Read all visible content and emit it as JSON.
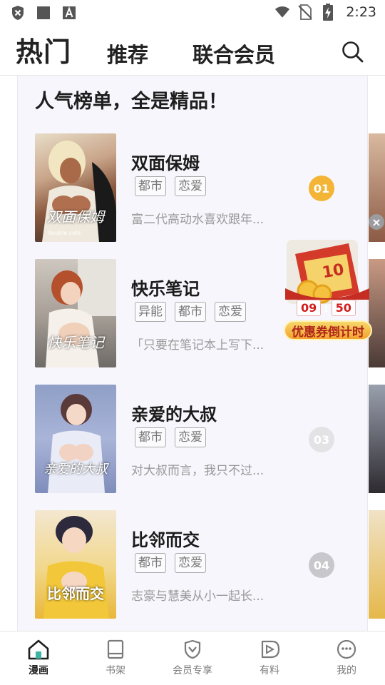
{
  "status_bar": {
    "time": "2:23",
    "icons": [
      "shield-x-icon",
      "square-icon",
      "text-a-icon",
      "wifi-icon",
      "no-sim-icon",
      "battery-charging-icon"
    ]
  },
  "header": {
    "tabs": [
      "热门",
      "推荐",
      "联合会员"
    ],
    "active_tab": "热门",
    "search_icon": "search-icon"
  },
  "ranking": {
    "title": "人气榜单，全是精品！",
    "items": [
      {
        "rank": "01",
        "title": "双面保姆",
        "tags": [
          "都市",
          "恋爱"
        ],
        "desc": "富二代高动水喜欢跟年...",
        "cover_text": "双面保姆",
        "cover_sub": "double side",
        "rank_color": "#f4b536"
      },
      {
        "rank": "02",
        "title": "快乐笔记",
        "tags": [
          "异能",
          "都市",
          "恋爱"
        ],
        "desc": "「只要在笔记本上写下...",
        "cover_text": "快乐笔记",
        "cover_sub": "",
        "rank_color": "#f0a030"
      },
      {
        "rank": "03",
        "title": "亲爱的大叔",
        "tags": [
          "都市",
          "恋爱"
        ],
        "desc": "对大叔而言，我只不过...",
        "cover_text": "亲爱的大叔",
        "cover_sub": "",
        "rank_color": "#e3e3e6"
      },
      {
        "rank": "04",
        "title": "比邻而交",
        "tags": [
          "都市",
          "恋爱"
        ],
        "desc": "志豪与慧美从小一起长...",
        "cover_text": "比邻而交",
        "cover_sub": "",
        "rank_color": "#c8c8cc"
      }
    ]
  },
  "coupon": {
    "amount": "10",
    "timer_min": "09",
    "timer_sec": "50",
    "label": "优惠券倒计时"
  },
  "bottom_nav": {
    "items": [
      {
        "label": "漫画",
        "icon": "home-icon",
        "active": true
      },
      {
        "label": "书架",
        "icon": "book-icon",
        "active": false
      },
      {
        "label": "会员专享",
        "icon": "vip-shield-icon",
        "active": false
      },
      {
        "label": "有料",
        "icon": "play-bubble-icon",
        "active": false
      },
      {
        "label": "我的",
        "icon": "smile-icon",
        "active": false
      }
    ]
  }
}
